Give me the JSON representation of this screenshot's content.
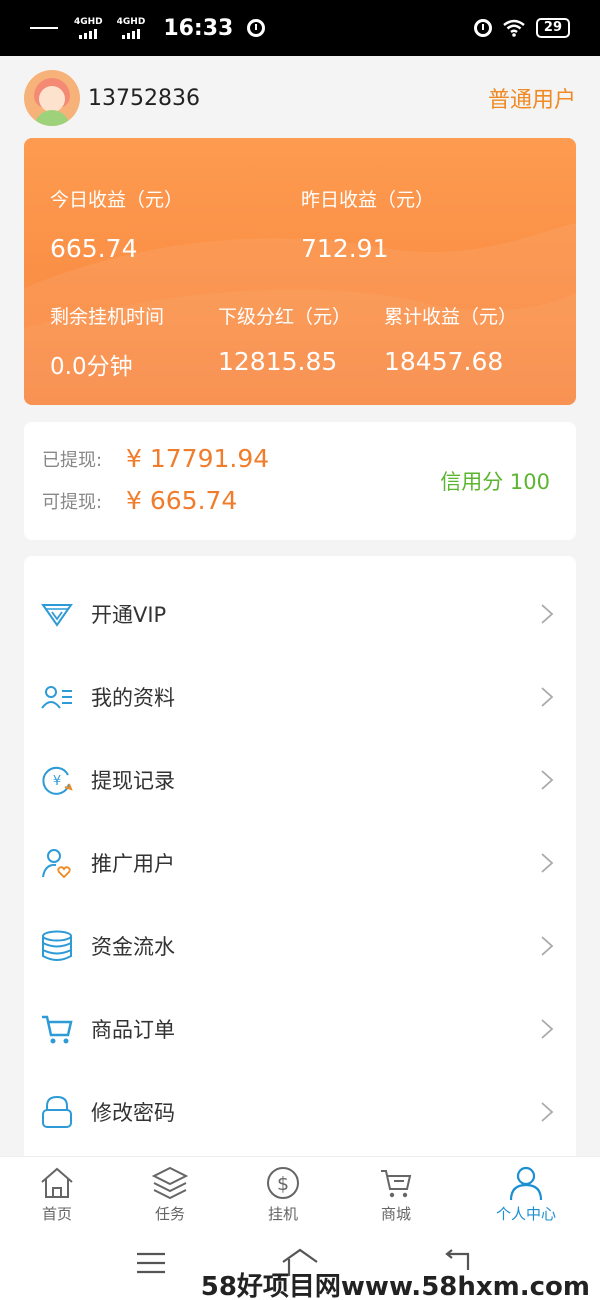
{
  "status_bar": {
    "network_1": "4GHD",
    "network_2": "4GHD",
    "time": "16:33",
    "battery": "29"
  },
  "header": {
    "phone": "13752836",
    "user_level": "普通用户"
  },
  "earnings": {
    "today_label": "今日收益（元）",
    "today_value": "665.74",
    "yesterday_label": "昨日收益（元）",
    "yesterday_value": "712.91",
    "remaining_label": "剩余挂机时间",
    "remaining_value": "0.0分钟",
    "sub_bonus_label": "下级分红（元）",
    "sub_bonus_value": "12815.85",
    "total_label": "累计收益（元）",
    "total_value": "18457.68"
  },
  "withdraw": {
    "withdrawn_label": "已提现:",
    "withdrawn_value": "¥ 17791.94",
    "available_label": "可提现:",
    "available_value": "¥ 665.74",
    "credit": "信用分 100"
  },
  "menu": {
    "items": [
      {
        "label": "开通VIP",
        "icon": "diamond-icon"
      },
      {
        "label": "我的资料",
        "icon": "profile-icon"
      },
      {
        "label": "提现记录",
        "icon": "yuan-cycle-icon"
      },
      {
        "label": "推广用户",
        "icon": "user-heart-icon"
      },
      {
        "label": "资金流水",
        "icon": "coin-stack-icon"
      },
      {
        "label": "商品订单",
        "icon": "cart-icon"
      },
      {
        "label": "修改密码",
        "icon": "lock-icon"
      }
    ]
  },
  "tabbar": {
    "tabs": [
      {
        "label": "首页",
        "icon": "home-icon"
      },
      {
        "label": "任务",
        "icon": "layers-icon"
      },
      {
        "label": "挂机",
        "icon": "dollar-icon"
      },
      {
        "label": "商城",
        "icon": "cart-icon"
      },
      {
        "label": "个人中心",
        "icon": "person-icon",
        "active": true
      }
    ]
  },
  "watermark": "58好项目网www.58hxm.com",
  "colors": {
    "accent_orange": "#f07d2c",
    "card_gradient_top": "#fd9b50",
    "card_gradient_bottom": "#f8853d",
    "credit_green": "#5cb531",
    "icon_blue": "#1b8fd2"
  }
}
